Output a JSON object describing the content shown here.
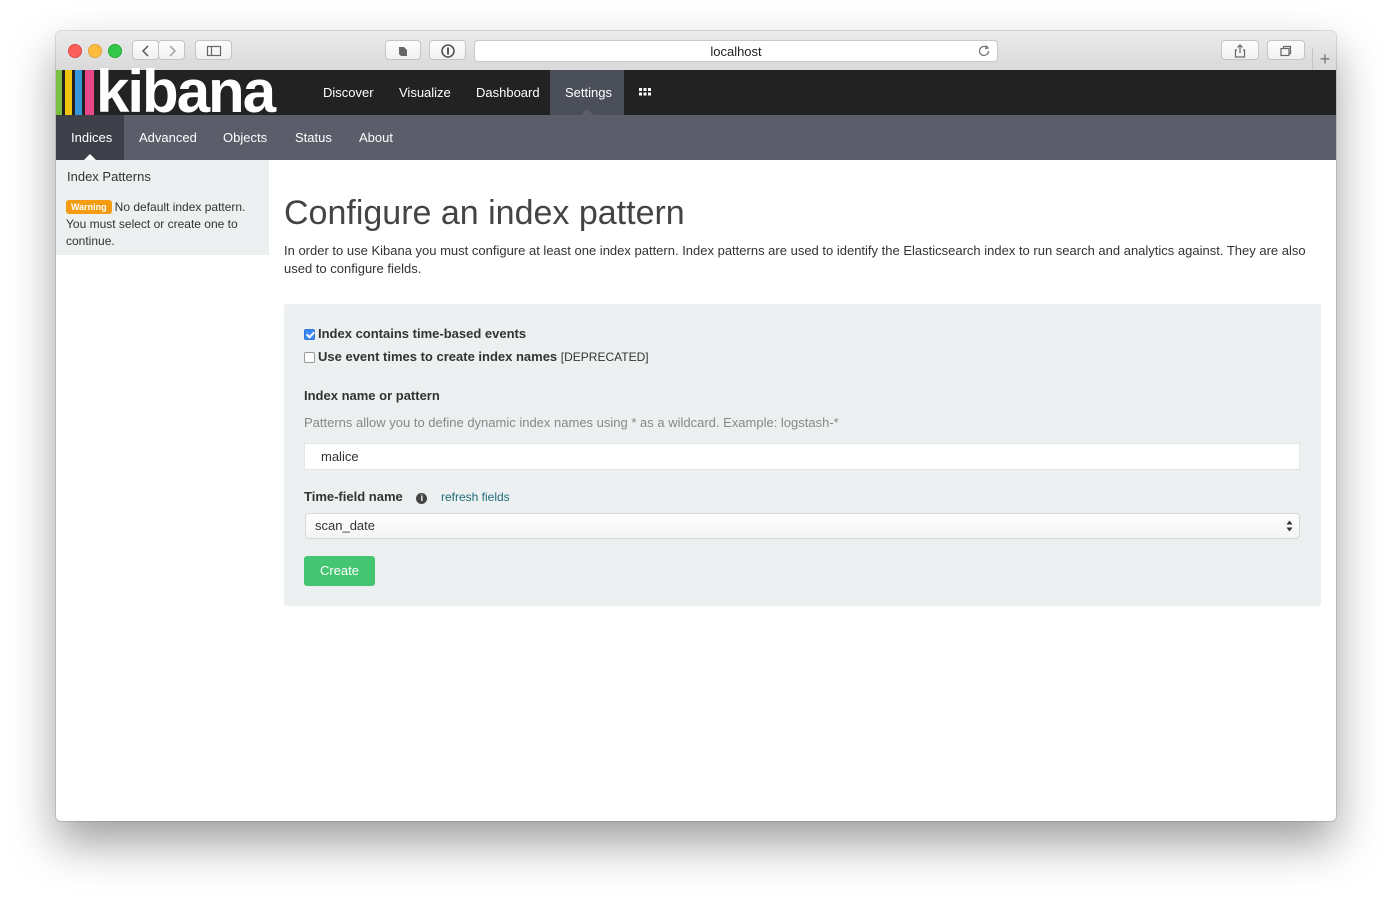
{
  "browser": {
    "url": "localhost"
  },
  "kibana": {
    "logo_text": "kibana",
    "brand_colors": [
      "#7bc043",
      "#f1c40f",
      "#3498db",
      "#e8488a"
    ],
    "nav": [
      {
        "label": "Discover"
      },
      {
        "label": "Visualize"
      },
      {
        "label": "Dashboard"
      },
      {
        "label": "Settings",
        "active": true
      }
    ],
    "subnav": [
      {
        "label": "Indices",
        "active": true
      },
      {
        "label": "Advanced"
      },
      {
        "label": "Objects"
      },
      {
        "label": "Status"
      },
      {
        "label": "About"
      }
    ]
  },
  "sidebar": {
    "title": "Index Patterns",
    "warning_badge": "Warning",
    "warning_text": "No default index pattern. You must select or create one to continue."
  },
  "main": {
    "title": "Configure an index pattern",
    "intro": "In order to use Kibana you must configure at least one index pattern. Index patterns are used to identify the Elasticsearch index to run search and analytics against. They are also used to configure fields.",
    "form": {
      "checkbox_time_based": {
        "label": "Index contains time-based events",
        "checked": true
      },
      "checkbox_event_times": {
        "label": "Use event times to create index names",
        "suffix": "[DEPRECATED]",
        "checked": false
      },
      "index_label": "Index name or pattern",
      "index_help": "Patterns allow you to define dynamic index names using * as a wildcard. Example: logstash-*",
      "index_value": "malice",
      "time_field_label": "Time-field name",
      "refresh_link": "refresh fields",
      "time_field_value": "scan_date",
      "create_label": "Create",
      "create_color": "#44c571"
    }
  }
}
